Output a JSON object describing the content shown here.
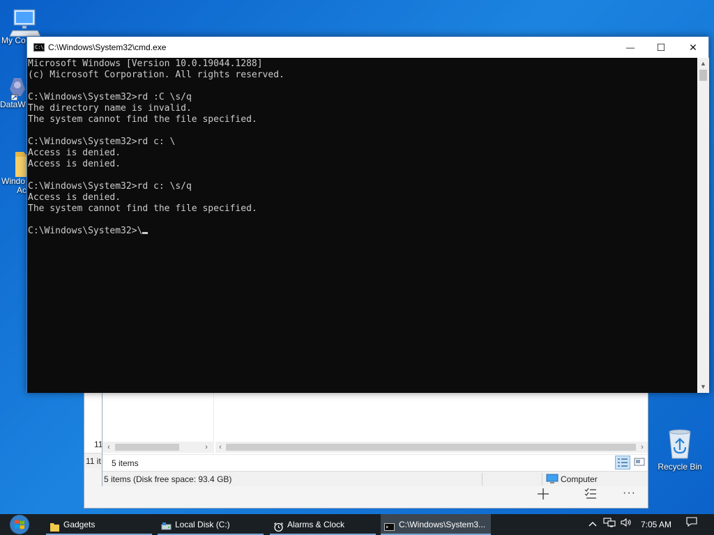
{
  "desktop": {
    "icons": [
      {
        "label": "My Co",
        "icon": "computer-icon"
      },
      {
        "label": "DataW",
        "icon": "app-shortcut-icon"
      },
      {
        "label": "Windo",
        "sub": "Ac",
        "icon": "folder-icon"
      },
      {
        "label": "Recycle Bin",
        "icon": "recycle-bin-icon"
      }
    ]
  },
  "explorer_back": {
    "items_partial": "11",
    "status_partial": "11 it",
    "toolbar_icons": [
      "add-icon",
      "checklist-icon",
      "more-icon"
    ],
    "more_label": "···"
  },
  "explorer_front": {
    "inner_status": "5 items",
    "status_left": "5 items (Disk free space: 93.4 GB)",
    "status_right": "Computer",
    "view_icons": [
      "details-view-icon",
      "preview-view-icon"
    ]
  },
  "cmd": {
    "title": "C:\\Windows\\System32\\cmd.exe",
    "app_icon_text": "C:\\",
    "buttons": {
      "minimize": "—",
      "maximize": "☐",
      "close": "✕"
    },
    "lines": [
      "Microsoft Windows [Version 10.0.19044.1288]",
      "(c) Microsoft Corporation. All rights reserved.",
      "",
      "C:\\Windows\\System32>rd :C \\s/q",
      "The directory name is invalid.",
      "The system cannot find the file specified.",
      "",
      "C:\\Windows\\System32>rd c: \\",
      "Access is denied.",
      "Access is denied.",
      "",
      "C:\\Windows\\System32>rd c: \\s/q",
      "Access is denied.",
      "The system cannot find the file specified.",
      ""
    ],
    "prompt": "C:\\Windows\\System32>\\"
  },
  "taskbar": {
    "items": [
      {
        "label": "Gadgets",
        "icon": "folder-icon"
      },
      {
        "label": "Local Disk (C:)",
        "icon": "drive-icon"
      },
      {
        "label": "Alarms & Clock",
        "icon": "alarm-clock-icon"
      },
      {
        "label": "C:\\Windows\\System3...",
        "icon": "cmd-icon"
      }
    ],
    "tray": {
      "chevron": "^",
      "clock": "7:05 AM"
    }
  },
  "colors": {
    "desktop": "#0a5fc8",
    "console_bg": "#0c0c0c",
    "console_fg": "#cccccc",
    "taskbar": "#1a1f24"
  }
}
